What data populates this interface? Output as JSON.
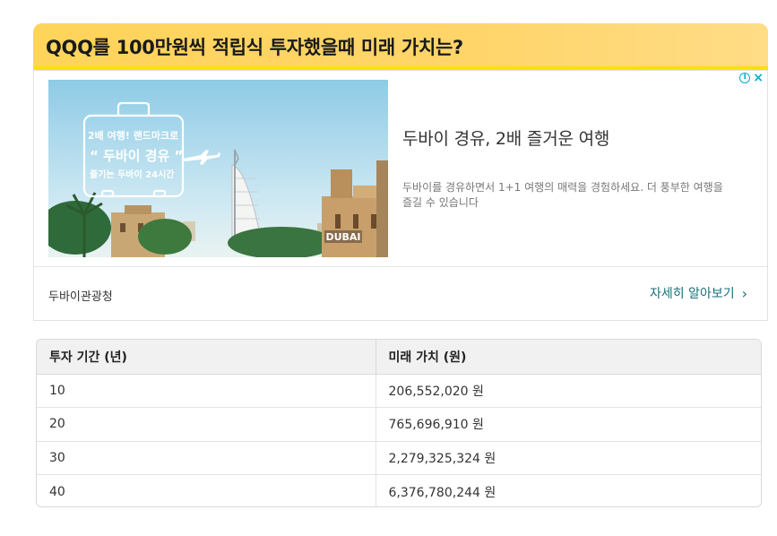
{
  "page": {
    "title": "QQQ를 100만원씩 적립식 투자했을때 미래 가치는?"
  },
  "ad": {
    "image_text": {
      "line1": "2배 여행! 랜드마크로",
      "line2": "“ 두바이 경유 ”",
      "line3": "즐기는 두바이 24시간",
      "badge": "DUBAI"
    },
    "headline": "두바이 경유, 2배 즐거운 여행",
    "description": "두바이를 경유하면서 1+1 여행의 매력을 경험하세요. 더 풍부한 여행을 즐길 수 있습니다",
    "advertiser": "두바이관광청",
    "cta": "자세히 알아보기",
    "choices_icons": [
      "info-icon",
      "close-icon"
    ],
    "colors": {
      "accent": "#00aecd",
      "cta": "#1a6e7a"
    }
  },
  "table": {
    "headers": [
      "투자 기간 (년)",
      "미래 가치 (원)"
    ],
    "rows": [
      [
        "10",
        "206,552,020 원"
      ],
      [
        "20",
        "765,696,910 원"
      ],
      [
        "30",
        "2,279,325,324 원"
      ],
      [
        "40",
        "6,376,780,244 원"
      ]
    ]
  },
  "colors": {
    "title_bg": "#ffd45a",
    "title_underline": "#f7e300",
    "table_header_bg": "#f1f1f1"
  }
}
